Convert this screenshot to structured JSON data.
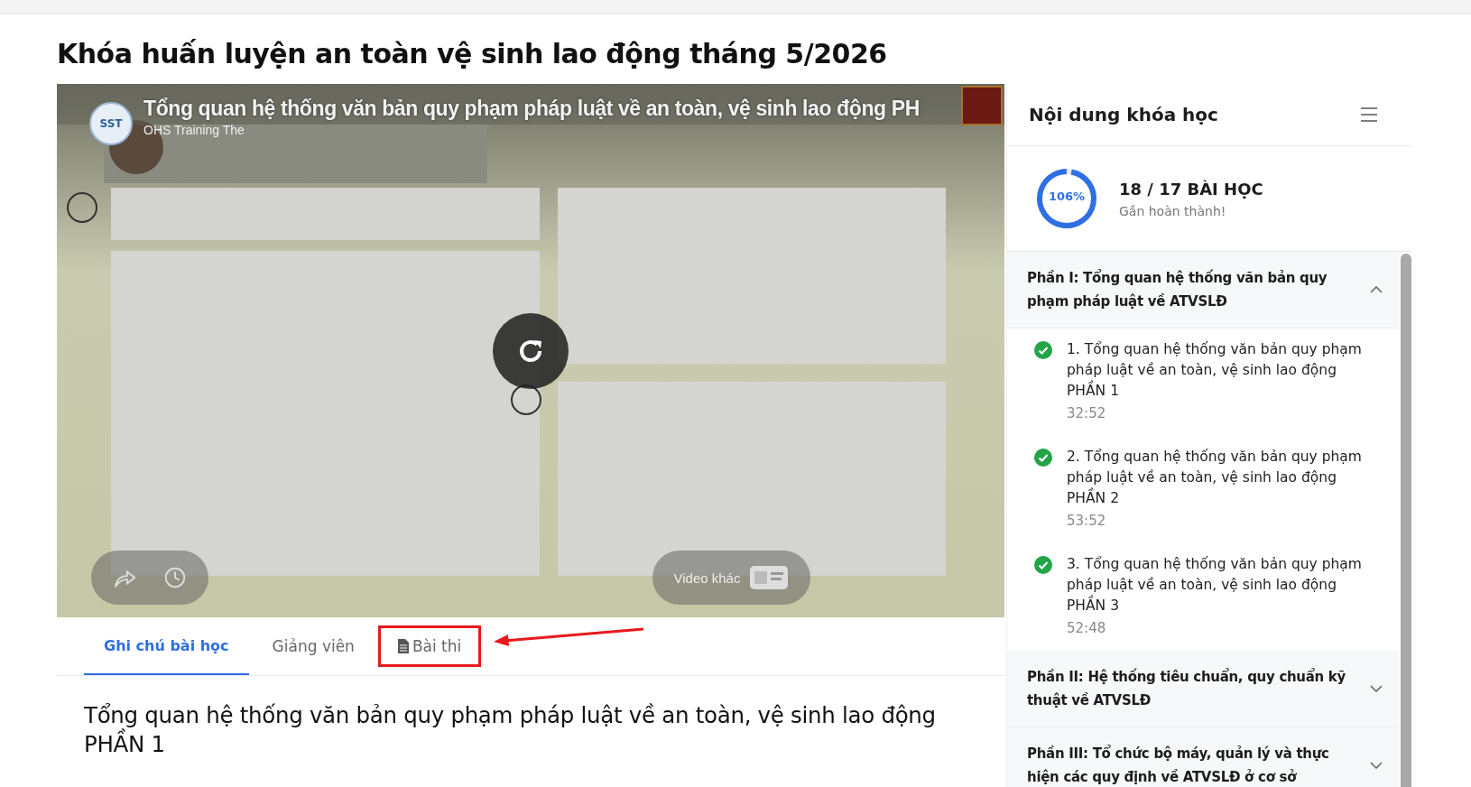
{
  "page_title": "Khóa huấn luyện an toàn vệ sinh lao động tháng 5/2026",
  "player": {
    "kind": "picture",
    "video_title": "Tổng quan hệ thống văn bản quy phạm pháp luật về an toàn, vệ sinh lao động PH",
    "channel_logo": "SST",
    "channel": "OHS Training The",
    "more_videos": "Video khác"
  },
  "tabs": [
    {
      "label": "Ghi chú bài học",
      "selected": true,
      "kind": "plain"
    },
    {
      "label": "Giảng viên",
      "selected": false,
      "kind": "plain"
    },
    {
      "label": "Bài thi",
      "selected": false,
      "kind": "document"
    }
  ],
  "lesson_heading": "Tổng quan hệ thống văn bản quy phạm pháp luật về an toàn, vệ sinh lao động PHẦN 1",
  "sidebar": {
    "title": "Nội dung khóa học",
    "progress": {
      "level": 0.97,
      "percent": "106%",
      "count": "18 / 17 BÀI HỌC",
      "status": "Gần hoàn thành!"
    },
    "sections": [
      {
        "title": "Phần I: Tổng quan hệ thống văn bản quy phạm pháp luật về ATVSLĐ",
        "expanded": true,
        "lessons": [
          {
            "title": "1. Tổng quan hệ thống văn bản quy phạm pháp luật về an toàn, vệ sinh lao động PHẦN 1",
            "duration": "32:52",
            "completed": true
          },
          {
            "title": "2. Tổng quan hệ thống văn bản quy phạm pháp luật về an toàn, vệ sinh lao động PHẦN 2",
            "duration": "53:52",
            "completed": true
          },
          {
            "title": "3. Tổng quan hệ thống văn bản quy phạm pháp luật về an toàn, vệ sinh lao động PHẦN 3",
            "duration": "52:48",
            "completed": true
          }
        ]
      },
      {
        "title": "Phần II: Hệ thống tiêu chuẩn, quy chuẩn kỹ thuật về ATVSLĐ",
        "expanded": false
      },
      {
        "title": "Phần III: Tổ chức bộ máy, quản lý và thực hiện các quy định về ATVSLĐ ở cơ sở",
        "expanded": false
      }
    ]
  }
}
